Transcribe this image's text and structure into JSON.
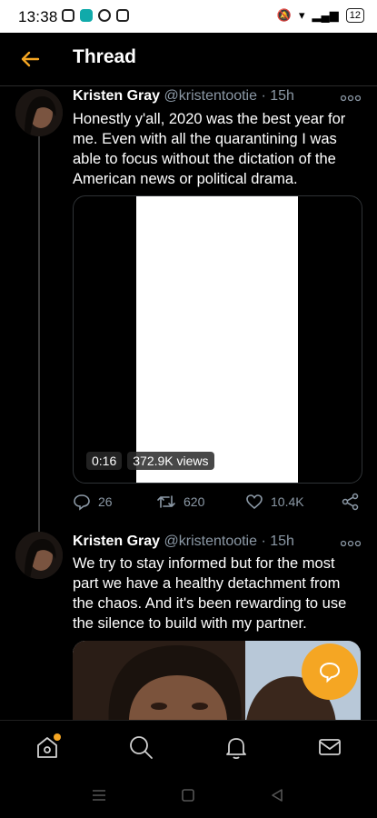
{
  "status": {
    "time": "13:38",
    "battery": "12"
  },
  "header": {
    "title": "Thread"
  },
  "tweets": [
    {
      "name": "Kristen Gray",
      "handle": "@kristentootie",
      "time": "15h",
      "text": "Honestly y'all, 2020 was the best year for me. Even with all the quarantining I was able to focus without the dictation of the American news or political drama.",
      "video": {
        "duration": "0:16",
        "views": "372.9K views"
      },
      "actions": {
        "replies": "26",
        "retweets": "620",
        "likes": "10.4K"
      }
    },
    {
      "name": "Kristen Gray",
      "handle": "@kristentootie",
      "time": "15h",
      "text": "We try to stay informed but for the most part we have a healthy detachment from the chaos. And it's been rewarding to use the silence to build with my partner."
    }
  ],
  "colors": {
    "accent": "#f5a623",
    "muted": "#8b98a5",
    "background": "#000000"
  },
  "icons": [
    "back-arrow-icon",
    "more-icon",
    "reply-icon",
    "retweet-icon",
    "like-icon",
    "share-icon",
    "compose-icon",
    "home-icon",
    "search-icon",
    "notifications-icon",
    "messages-icon"
  ]
}
